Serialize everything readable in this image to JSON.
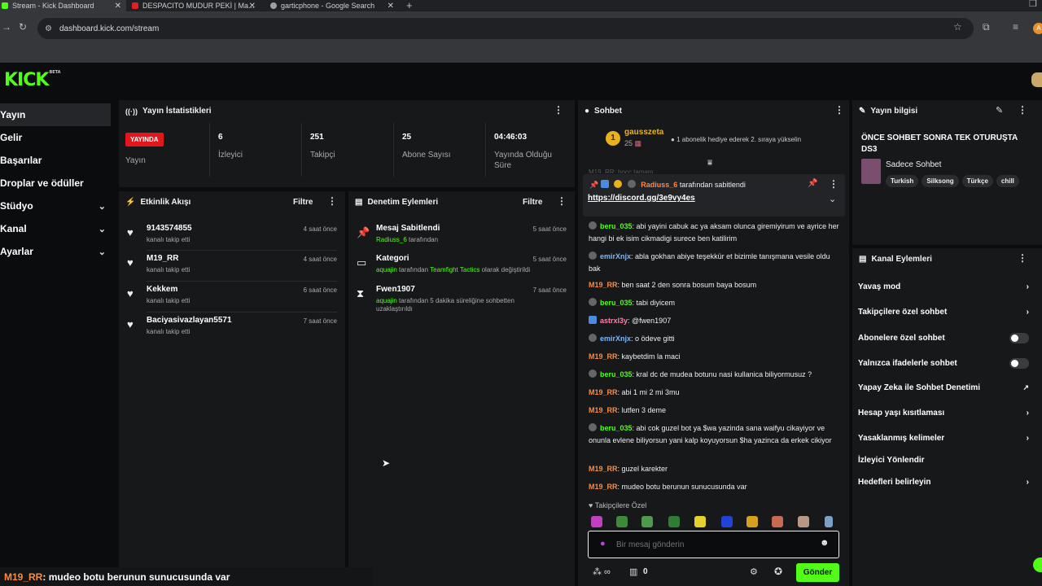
{
  "browser": {
    "tabs": [
      {
        "title": "Stream - Kick Dashboard"
      },
      {
        "title": "DESPACITO MUDUR PEKİ | Ma..."
      },
      {
        "title": "garticphone - Google Search"
      }
    ],
    "url": "dashboard.kick.com/stream"
  },
  "brand": {
    "logo": "KICK",
    "beta": "BETA",
    "accent": "#53fc18"
  },
  "sidebar": {
    "items": [
      {
        "label": "Yayın"
      },
      {
        "label": "Gelir"
      },
      {
        "label": "Başarılar"
      },
      {
        "label": "Droplar ve ödüller"
      },
      {
        "label": "Stüdyo"
      },
      {
        "label": "Kanal"
      },
      {
        "label": "Ayarlar"
      }
    ]
  },
  "stats": {
    "title": "Yayın İstatistikleri",
    "live_badge": "YAYINDA",
    "live_label": "Yayın",
    "items": [
      {
        "value": "6",
        "label": "İzleyici"
      },
      {
        "value": "251",
        "label": "Takipçi"
      },
      {
        "value": "25",
        "label": "Abone Sayısı"
      },
      {
        "value": "04:46:03",
        "label": "Yayında Olduğu Süre"
      }
    ]
  },
  "activity": {
    "title": "Etkinlik Akışı",
    "filter": "Filtre",
    "events": [
      {
        "name": "9143574855",
        "sub": "kanalı takip etti",
        "time": "4 saat önce"
      },
      {
        "name": "M19_RR",
        "sub": "kanalı takip etti",
        "time": "4 saat önce"
      },
      {
        "name": "Kekkem",
        "sub": "kanalı takip etti",
        "time": "6 saat önce"
      },
      {
        "name": "Baciyasivazlayan5571",
        "sub": "kanalı takip etti",
        "time": "7 saat önce"
      }
    ]
  },
  "moderation": {
    "title": "Denetim Eylemleri",
    "filter": "Filtre",
    "actions": [
      {
        "name": "Mesaj Sabitlendi",
        "user": "Radiuss_6",
        "text": "tarafından",
        "time": "5 saat önce"
      },
      {
        "name": "Kategori",
        "user": "aquajin",
        "text": "tarafından",
        "game": "Teamfight Tactics",
        "text2": "olarak değiştirildi",
        "time": "5 saat önce"
      },
      {
        "name": "Fwen1907",
        "user": "aquajin",
        "text": "tarafından 5 dakika süreliğine sohbetten uzaklaştırıldı",
        "time": "7 saat önce"
      }
    ]
  },
  "chat": {
    "title": "Sohbet",
    "top_gifter": {
      "rank": "1",
      "name": "gausszeta",
      "count": "25",
      "note": "1 abonelik hediye ederek 2. sıraya yükselin"
    },
    "cut_line": "M19_RR: hocc tamam",
    "pinned": {
      "by": "Radiuss_6",
      "by_text": "tarafından sabitlendi",
      "link": "https://discord.gg/3e9vy4es"
    },
    "messages": [
      {
        "user": "beru_035",
        "color": "#53fc18",
        "text": ": abi yayini cabuk ac ya aksam olunca giremiyirum ve ayrice her hangi bi ek isim cikmadigi surece ben katilirim"
      },
      {
        "user": "emirXnjx",
        "color": "#7ab8ff",
        "text": ": abla gokhan abiye teşekkür et bizimle tanışmana vesile oldu bak"
      },
      {
        "user": "M19_RR",
        "color": "#ff8a3d",
        "text": ": ben saat 2 den sonra bosum baya bosum"
      },
      {
        "user": "beru_035",
        "color": "#53fc18",
        "text": ": tabi diyicem"
      },
      {
        "user": "astrxl3y",
        "color": "#ff7fb0",
        "text": ": @fwen1907"
      },
      {
        "user": "emirXnjx",
        "color": "#7ab8ff",
        "text": ": o ödeve gitti"
      },
      {
        "user": "M19_RR",
        "color": "#ff8a3d",
        "text": ": kaybetdim la maci"
      },
      {
        "user": "beru_035",
        "color": "#53fc18",
        "text": ": kral dc de mudea botunu nasi kullanica biliyormusuz ?"
      },
      {
        "user": "M19_RR",
        "color": "#ff8a3d",
        "text": ": abi 1 mi 2 mi 3mu"
      },
      {
        "user": "M19_RR",
        "color": "#ff8a3d",
        "text": ": lutfen 3 deme"
      },
      {
        "user": "beru_035",
        "color": "#53fc18",
        "text": ": abi cok guzel bot ya $wa yazinda sana waifyu cikayiyor ve onunla evlene biliyorsun yani kalp koyuyorsun $ha yazinca da erkek cikiyor"
      },
      {
        "user": "M19_RR",
        "color": "#ff8a3d",
        "text": ": guzel karekter"
      },
      {
        "user": "M19_RR",
        "color": "#ff8a3d",
        "text": ": mudeo botu berunun sunucusunda var"
      }
    ],
    "followers_only": "Takipçilere Özel",
    "input_placeholder": "Bir mesaj gönderin",
    "points": "0",
    "send": "Gönder"
  },
  "stream_info": {
    "title": "Yayın bilgisi",
    "stream_title": "ÖNCE SOHBET SONRA TEK OTURUŞTA DS3",
    "category": "Sadece Sohbet",
    "tags": [
      "Turkish",
      "Silksong",
      "Türkçe",
      "chill"
    ]
  },
  "channel_actions": {
    "title": "Kanal Eylemleri",
    "items": [
      {
        "label": "Yavaş mod",
        "control": "chevron"
      },
      {
        "label": "Takipçilere özel sohbet",
        "control": "chevron"
      },
      {
        "label": "Abonelere özel sohbet",
        "control": "toggle"
      },
      {
        "label": "Yalnızca ifadelerle sohbet",
        "control": "toggle"
      },
      {
        "label": "Yapay Zeka ile Sohbet Denetimi",
        "control": "external"
      },
      {
        "label": "Hesap yaşı kısıtlaması",
        "control": "chevron"
      },
      {
        "label": "Yasaklanmış kelimeler",
        "control": "chevron"
      },
      {
        "label": "İzleyici Yönlendir",
        "control": "none"
      },
      {
        "label": "Hedefleri belirleyin",
        "control": "chevron"
      }
    ]
  },
  "overlay": {
    "user": "M19_RR",
    "text": " : mudeo botu berunun sunucusunda var"
  }
}
